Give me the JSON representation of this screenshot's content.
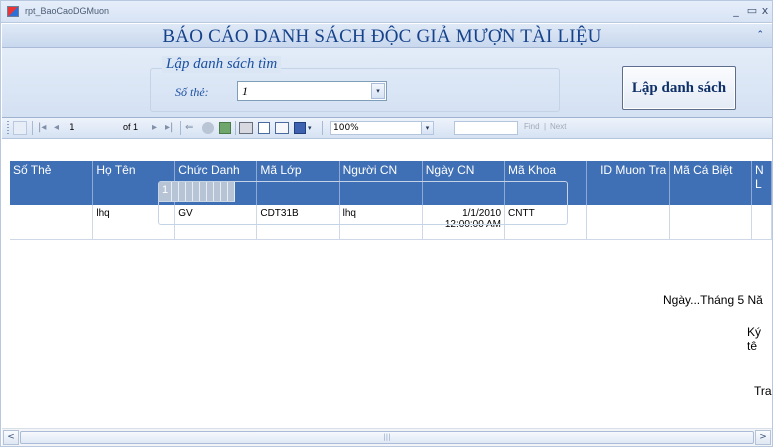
{
  "window": {
    "title": "rpt_BaoCaoDGMuon",
    "minimize_glyph": "_",
    "maximize_glyph": "▭",
    "close_glyph": "x"
  },
  "header": {
    "title": "BÁO CÁO DANH SÁCH ĐỘC GIẢ MƯỢN TÀI LIỆU",
    "collapse_glyph": "⌃"
  },
  "form": {
    "group_title": "Lập danh sách tìm",
    "card_label": "Số thẻ:",
    "card_value": "1",
    "combo_arrow": "▾",
    "make_button_label": "Lập danh sách"
  },
  "toolbar": {
    "page_value": "1",
    "of_label": "of 1",
    "zoom_value": "100%",
    "find_label": "Find",
    "separator": "|",
    "next_label": "Next",
    "search_value": ""
  },
  "table": {
    "columns": [
      "Số Thẻ",
      "Họ Tên",
      "Chức Danh",
      "Mã Lớp",
      "Người CN",
      "Ngày CN",
      "Mã Khoa",
      "ID Muon Tra",
      "Mã Cá Biệt",
      "N L"
    ],
    "group_label": "1",
    "rows": [
      {
        "so_the": "",
        "ho_ten": "lhq",
        "chuc_danh": "GV",
        "ma_lop": "CDT31B",
        "nguoi_cn": "lhq",
        "ngay_cn_date": "1/1/2010",
        "ngay_cn_time": "12:00:00 AM",
        "ma_khoa": "CNTT",
        "id_muon_tra": "",
        "ma_ca_biet": "",
        "extra": ""
      }
    ]
  },
  "footer": {
    "date_line": "Ngày...Tháng 5 Nă",
    "signature": "Ký tê",
    "page": "Tra"
  },
  "scrollbar": {
    "left_arrow": "<",
    "right_arrow": ">",
    "grip": "|||"
  }
}
